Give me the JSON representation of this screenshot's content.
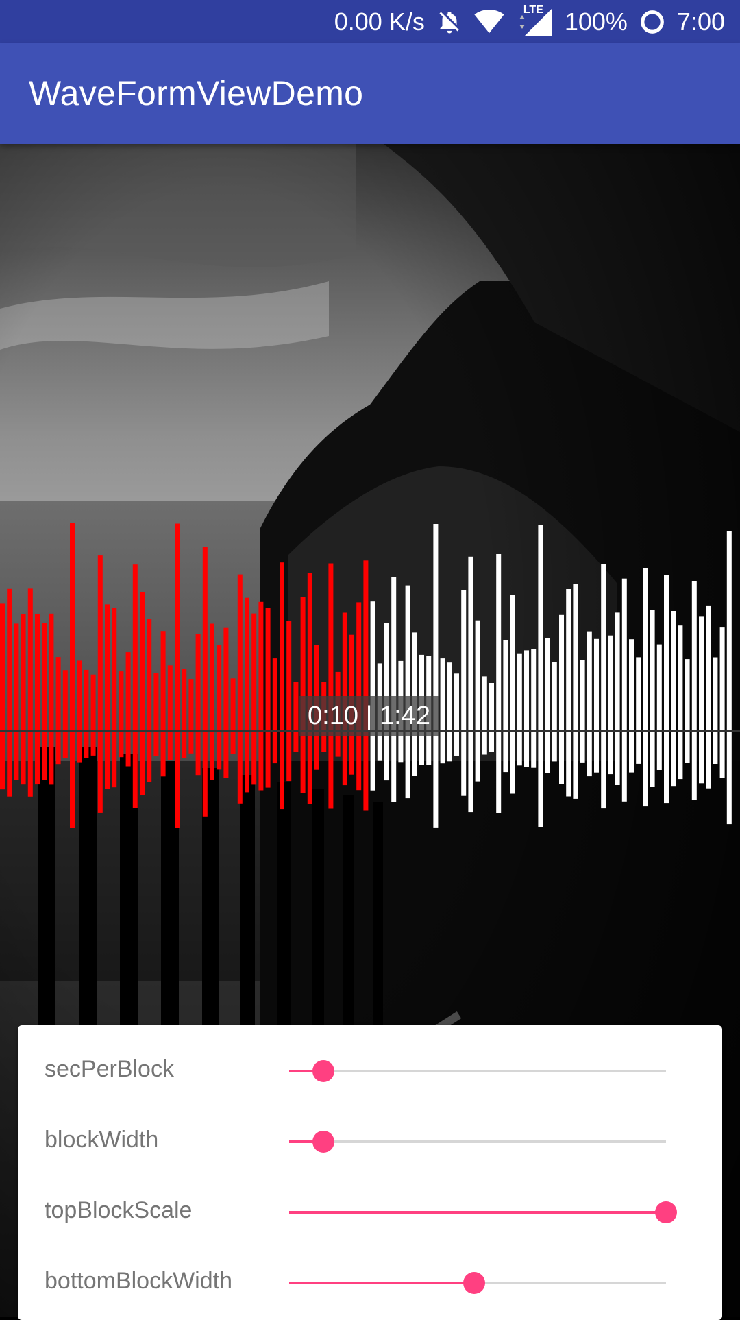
{
  "status_bar": {
    "net_speed": "0.00 K/s",
    "network_type": "LTE",
    "battery": "100%",
    "time": "7:00",
    "icons": [
      "notifications-off-icon",
      "wifi-icon",
      "lte-signal-icon",
      "battery-circle-icon"
    ]
  },
  "app_bar": {
    "title": "WaveFormViewDemo"
  },
  "waveform": {
    "current_time": "0:10",
    "separator": "|",
    "total_time": "1:42",
    "time_label": "0:10 | 1:42",
    "played_color": "#FF0000",
    "unplayed_color": "#FFFFFF",
    "progress_fraction": 0.1
  },
  "controls": [
    {
      "label": "secPerBlock",
      "value_fraction": 0.09
    },
    {
      "label": "blockWidth",
      "value_fraction": 0.09
    },
    {
      "label": "topBlockScale",
      "value_fraction": 1.0
    },
    {
      "label": "bottomBlockWidth",
      "value_fraction": 0.49
    }
  ],
  "colors": {
    "primary": "#3F51B5",
    "primary_dark": "#303F9F",
    "accent": "#FF4081"
  }
}
